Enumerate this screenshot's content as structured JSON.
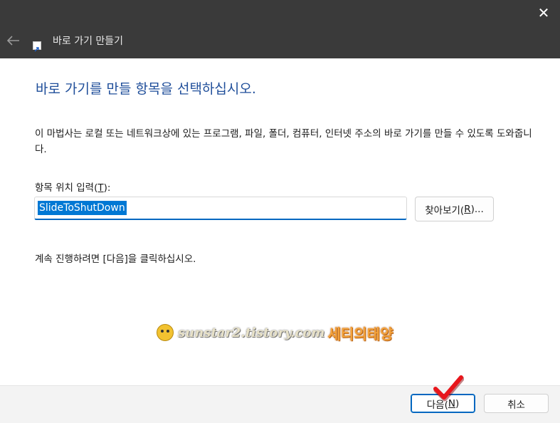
{
  "window": {
    "title": "바로 가기 만들기",
    "close_glyph": "✕",
    "back_icon": "arrow-left-icon",
    "app_icon": "shortcut-icon"
  },
  "main": {
    "heading": "바로 가기를 만들 항목을 선택하십시오.",
    "description": "이 마법사는 로컬 또는 네트워크상에 있는 프로그램, 파일, 폴더, 컴퓨터, 인터넷 주소의 바로 가기를 만들 수 있도록 도와줍니다.",
    "field_label_prefix": "항목 위치 입력(",
    "field_label_key": "T",
    "field_label_suffix": "):",
    "path_value": "SlideToShutDown",
    "browse_prefix": "찾아보기(",
    "browse_key": "R",
    "browse_suffix": ")...",
    "continue_text": "계속 진행하려면 [다음]을 클릭하십시오."
  },
  "watermark": {
    "url": "sunstar2.tistory.com",
    "name": "세티의태양"
  },
  "footer": {
    "next_prefix": "다음(",
    "next_key": "N",
    "next_suffix": ")",
    "cancel_label": "취소"
  },
  "colors": {
    "titlebar": "#3a3a3a",
    "heading": "#1f4e9a",
    "accent": "#0067c0",
    "selection": "#0078d4",
    "checkmark": "#e8161c"
  }
}
